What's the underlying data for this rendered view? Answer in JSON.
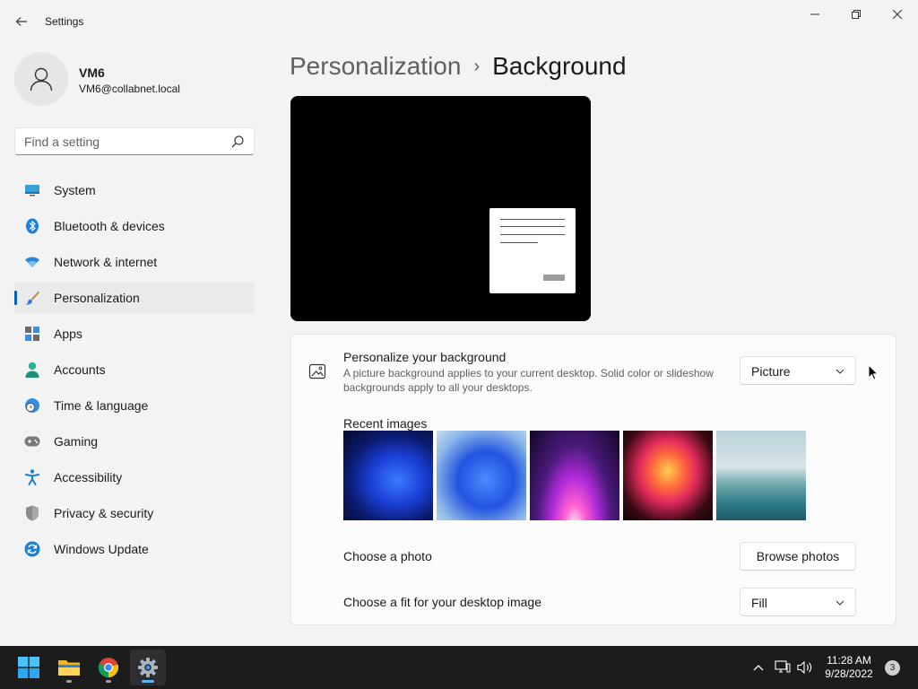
{
  "window": {
    "title": "Settings"
  },
  "profile": {
    "name": "VM6",
    "email": "VM6@collabnet.local"
  },
  "search": {
    "placeholder": "Find a setting"
  },
  "nav": {
    "items": [
      {
        "label": "System",
        "icon": "monitor-icon"
      },
      {
        "label": "Bluetooth & devices",
        "icon": "bluetooth-icon"
      },
      {
        "label": "Network & internet",
        "icon": "wifi-icon"
      },
      {
        "label": "Personalization",
        "icon": "paintbrush-icon",
        "active": true
      },
      {
        "label": "Apps",
        "icon": "apps-icon"
      },
      {
        "label": "Accounts",
        "icon": "person-icon"
      },
      {
        "label": "Time & language",
        "icon": "globe-clock-icon"
      },
      {
        "label": "Gaming",
        "icon": "gamepad-icon"
      },
      {
        "label": "Accessibility",
        "icon": "accessibility-icon"
      },
      {
        "label": "Privacy & security",
        "icon": "shield-icon"
      },
      {
        "label": "Windows Update",
        "icon": "update-icon"
      }
    ]
  },
  "breadcrumb": {
    "parent": "Personalization",
    "separator": "›",
    "current": "Background"
  },
  "background": {
    "title": "Personalize your background",
    "description": "A picture background applies to your current desktop. Solid color or slideshow backgrounds apply to all your desktops.",
    "selected": "Picture"
  },
  "recent": {
    "label": "Recent images"
  },
  "photo": {
    "label": "Choose a photo",
    "button": "Browse photos"
  },
  "fit": {
    "label": "Choose a fit for your desktop image",
    "selected": "Fill"
  },
  "taskbar": {
    "time": "11:28 AM",
    "date": "9/28/2022",
    "notifications": "3"
  },
  "colors": {
    "accent": "#005fb8",
    "taskbar": "#1c1c1c",
    "window": "#f3f3f3"
  }
}
